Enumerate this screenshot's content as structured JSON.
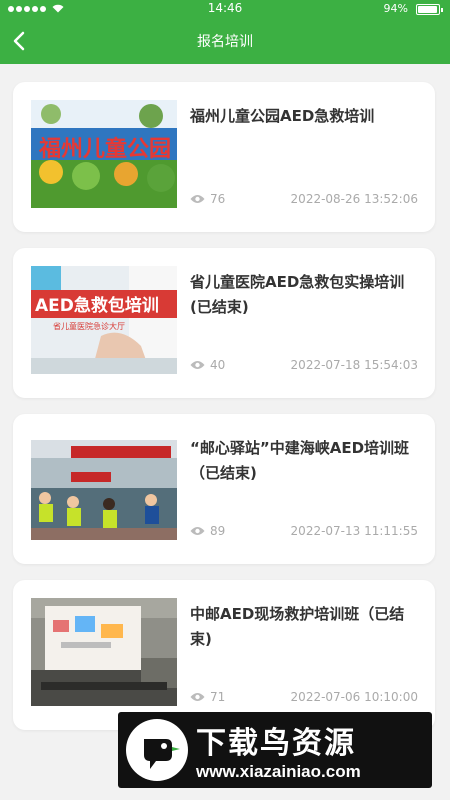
{
  "status_bar": {
    "time": "14:46",
    "battery": "94%",
    "battery_level": 0.94
  },
  "nav": {
    "back_icon": "chevron-left-icon",
    "title": "报名培训"
  },
  "colors": {
    "brand_green": "#3cb043",
    "card_bg": "#ffffff",
    "meta_gray": "#aaaaaa"
  },
  "items": [
    {
      "title": "福州儿童公园AED急救培训",
      "views": "76",
      "date": "2022-08-26 13:52:06",
      "thumb_text": "福州儿童公园"
    },
    {
      "title": "省儿童医院AED急救包实操培训(已结束)",
      "views": "40",
      "date": "2022-07-18 15:54:03",
      "thumb_text": "AED急救包培训",
      "thumb_sub": "省儿童医院急诊大厅"
    },
    {
      "title": "“邮心驿站”中建海峡AED培训班（已结束)",
      "views": "89",
      "date": "2022-07-13 11:11:55"
    },
    {
      "title": "中邮AED现场救护培训班（已结束)",
      "views": "71",
      "date": "2022-07-06 10:10:00"
    }
  ],
  "watermark": {
    "title": "下载鸟资源",
    "url": "www.xiazainiao.com"
  }
}
